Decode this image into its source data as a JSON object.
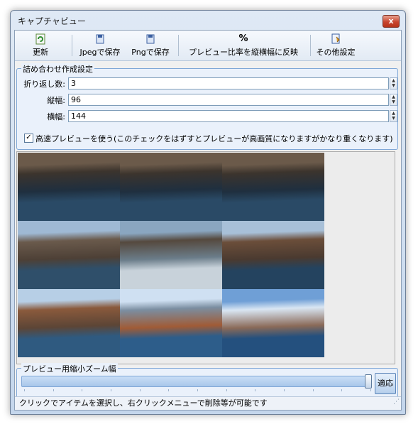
{
  "window": {
    "title": "キャプチャビュー",
    "close_glyph": "x"
  },
  "toolbar": {
    "refresh_label": "更新",
    "jpeg_save_label": "Jpegで保存",
    "png_save_label": "Pngで保存",
    "ratio_label": "プレビュー比率を縦横幅に反映",
    "ratio_glyph": "%",
    "other_settings_label": "その他設定"
  },
  "tile_settings": {
    "group_title": "詰め合わせ作成設定",
    "wrap_label": "折り返し数:",
    "wrap_value": "3",
    "height_label": "縦幅:",
    "height_value": "96",
    "width_label": "横幅:",
    "width_value": "144",
    "fast_preview_checked": true,
    "fast_preview_label": "高速プレビューを使う(このチェックをはずすとプレビューが高画質になりますがかなり重くなります)"
  },
  "thumbnails": [
    {
      "scene": "cliff-coast-dark"
    },
    {
      "scene": "cliff-coast-dark"
    },
    {
      "scene": "cliff-coast-dark"
    },
    {
      "scene": "cliff-rock"
    },
    {
      "scene": "cliff-rock-splash"
    },
    {
      "scene": "cliff-rock-sea"
    },
    {
      "scene": "coast-arch"
    },
    {
      "scene": "coast-sky"
    },
    {
      "scene": "coast-sky-blue"
    }
  ],
  "zoom": {
    "group_title": "プレビュー用縮小ズーム幅",
    "slider_value": 1.0,
    "fit_button_label": "適応"
  },
  "status": {
    "text": "クリックでアイテムを選択し、右クリックメニューで削除等が可能です"
  }
}
